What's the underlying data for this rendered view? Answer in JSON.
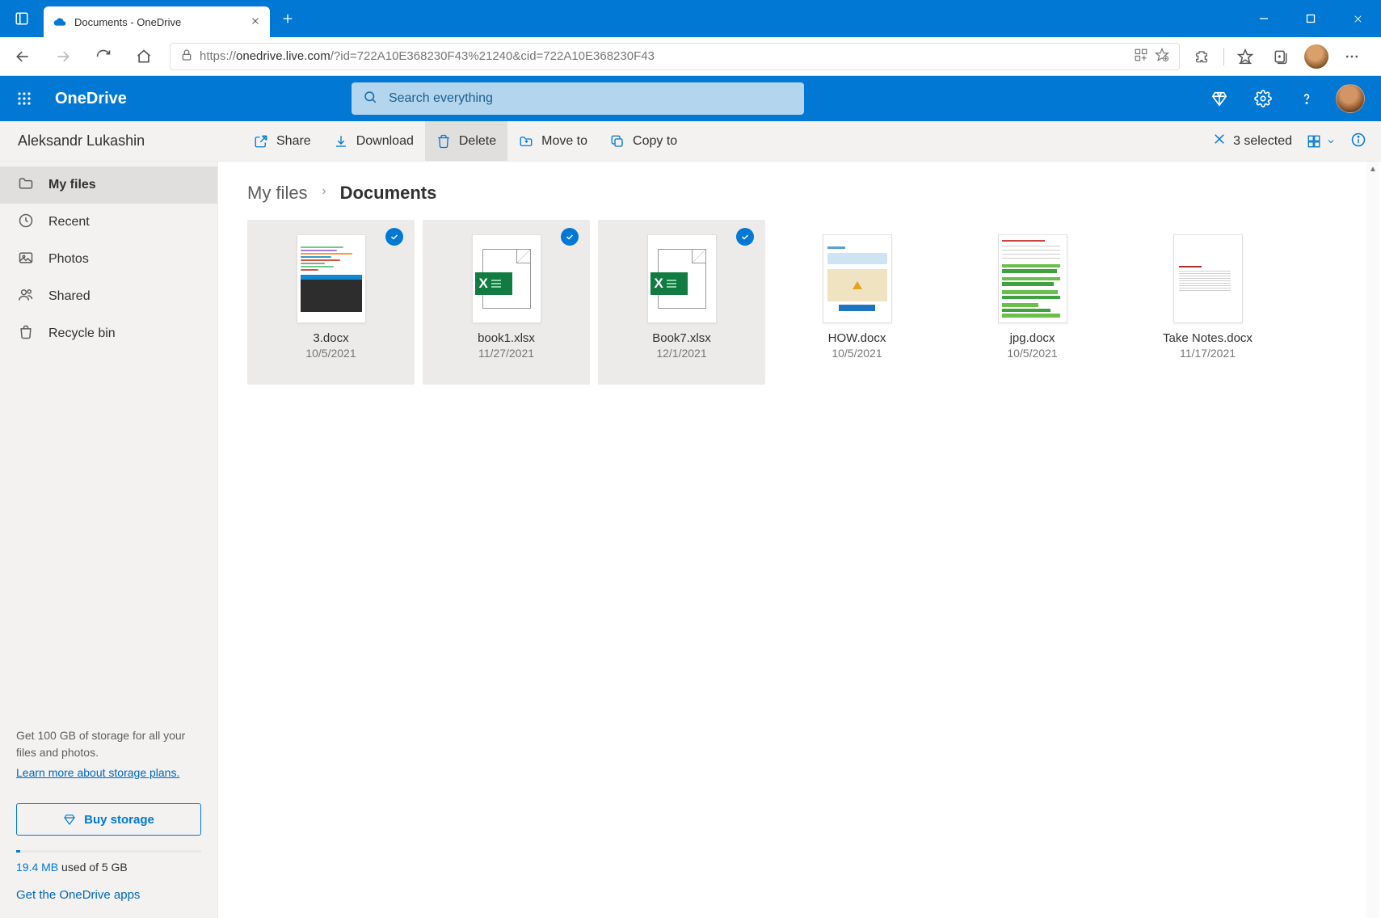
{
  "browser": {
    "tab_title": "Documents - OneDrive",
    "url_full": "https://onedrive.live.com/?id=722A10E368230F43%21240&cid=722A10E368230F43",
    "url_protocol": "https://",
    "url_host": "onedrive.live.com",
    "url_path": "/?id=722A10E368230F43%21240&cid=722A10E368230F43"
  },
  "suite": {
    "brand": "OneDrive",
    "search_placeholder": "Search everything"
  },
  "user": {
    "name": "Aleksandr Lukashin"
  },
  "commands": {
    "share": "Share",
    "download": "Download",
    "delete": "Delete",
    "move": "Move to",
    "copy": "Copy to",
    "selection": "3 selected"
  },
  "nav": {
    "items": [
      {
        "label": "My files",
        "icon": "folder",
        "active": true
      },
      {
        "label": "Recent",
        "icon": "clock",
        "active": false
      },
      {
        "label": "Photos",
        "icon": "image",
        "active": false
      },
      {
        "label": "Shared",
        "icon": "people",
        "active": false
      },
      {
        "label": "Recycle bin",
        "icon": "trash",
        "active": false
      }
    ]
  },
  "storage": {
    "promo": "Get 100 GB of storage for all your files and photos.",
    "learn_more": "Learn more about storage plans.",
    "buy": "Buy storage",
    "usage_value": "19.4 MB",
    "usage_text": " used of 5 GB",
    "get_apps": "Get the OneDrive apps"
  },
  "breadcrumb": {
    "seg1": "My files",
    "seg2": "Documents"
  },
  "files": [
    {
      "name": "3.docx",
      "date": "10/5/2021",
      "type": "doc-code",
      "selected": true
    },
    {
      "name": "book1.xlsx",
      "date": "11/27/2021",
      "type": "xlsx",
      "selected": true
    },
    {
      "name": "Book7.xlsx",
      "date": "12/1/2021",
      "type": "xlsx",
      "selected": true
    },
    {
      "name": "HOW.docx",
      "date": "10/5/2021",
      "type": "doc-how",
      "selected": false
    },
    {
      "name": "jpg.docx",
      "date": "10/5/2021",
      "type": "doc-img",
      "selected": false
    },
    {
      "name": "Take Notes.docx",
      "date": "11/17/2021",
      "type": "doc-notes",
      "selected": false
    }
  ]
}
